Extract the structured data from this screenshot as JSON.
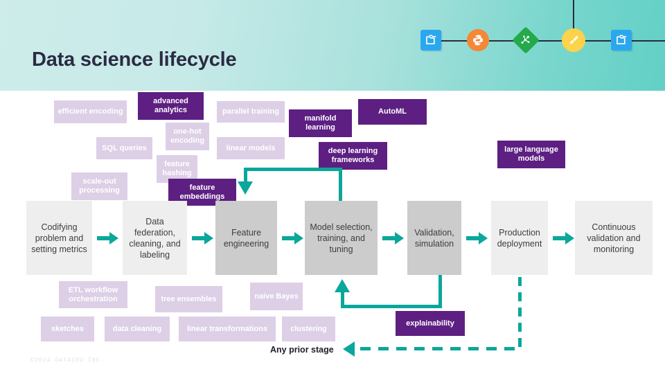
{
  "slide": {
    "title": "Data science lifecycle",
    "footer": "©2024 DATAIKU INC.",
    "accent_teal": "#0aa79b",
    "accent_purple_dark": "#5d1f82",
    "accent_purple_light": "#dccfe6",
    "header_gradient_from": "#cdecea",
    "header_gradient_to": "#62d0c6",
    "title_color": "#2b2b44"
  },
  "header_flow": {
    "nodes": [
      {
        "icon": "dataset-icon",
        "color": "#2ba7f0",
        "shape": "square"
      },
      {
        "icon": "python-recipe-icon",
        "color": "#f58735",
        "shape": "circle"
      },
      {
        "icon": "model-recipe-icon",
        "color": "#24a94b",
        "shape": "diamond"
      },
      {
        "icon": "prepare-recipe-icon",
        "color": "#fcd349",
        "shape": "circle"
      },
      {
        "icon": "dataset-icon",
        "color": "#2ba7f0",
        "shape": "square"
      }
    ]
  },
  "stages": [
    {
      "label": "Codifying problem and setting metrics",
      "tone": "light"
    },
    {
      "label": "Data federation, cleaning, and labeling",
      "tone": "light"
    },
    {
      "label": "Feature engineering",
      "tone": "dark"
    },
    {
      "label": "Model selection, training, and tuning",
      "tone": "dark"
    },
    {
      "label": "Validation, simulation",
      "tone": "dark"
    },
    {
      "label": "Production deployment",
      "tone": "light"
    },
    {
      "label": "Continuous validation and monitoring",
      "tone": "light"
    }
  ],
  "tags_top": [
    {
      "label": "efficient encoding",
      "tone": "light"
    },
    {
      "label": "advanced analytics",
      "tone": "dark"
    },
    {
      "label": "parallel training",
      "tone": "light"
    },
    {
      "label": "manifold learning",
      "tone": "dark"
    },
    {
      "label": "AutoML",
      "tone": "dark"
    },
    {
      "label": "SQL queries",
      "tone": "light"
    },
    {
      "label": "one-hot encoding",
      "tone": "light"
    },
    {
      "label": "linear models",
      "tone": "light"
    },
    {
      "label": "deep learning frameworks",
      "tone": "dark"
    },
    {
      "label": "large language models",
      "tone": "dark"
    },
    {
      "label": "scale-out processing",
      "tone": "light"
    },
    {
      "label": "feature hashing",
      "tone": "light"
    },
    {
      "label": "feature embeddings",
      "tone": "dark"
    }
  ],
  "tags_bottom": [
    {
      "label": "ETL workflow orchestration",
      "tone": "light"
    },
    {
      "label": "tree ensembles",
      "tone": "light"
    },
    {
      "label": "naive Bayes",
      "tone": "light"
    },
    {
      "label": "sketches",
      "tone": "light"
    },
    {
      "label": "data cleaning",
      "tone": "light"
    },
    {
      "label": "linear transformations",
      "tone": "light"
    },
    {
      "label": "clustering",
      "tone": "light"
    },
    {
      "label": "explainability",
      "tone": "dark"
    }
  ],
  "annotations": {
    "any_prior_stage": "Any prior stage"
  }
}
